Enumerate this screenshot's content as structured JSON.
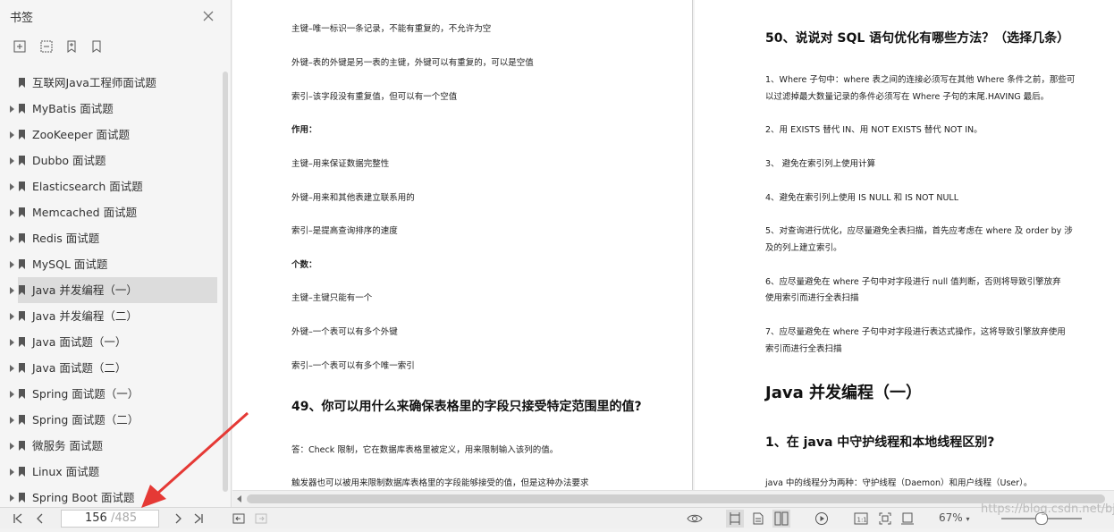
{
  "sidebar": {
    "title": "书签",
    "items": [
      {
        "label": "互联网Java工程师面试题",
        "expandable": false
      },
      {
        "label": "MyBatis 面试题",
        "expandable": true
      },
      {
        "label": "ZooKeeper 面试题",
        "expandable": true
      },
      {
        "label": "Dubbo 面试题",
        "expandable": true
      },
      {
        "label": "Elasticsearch 面试题",
        "expandable": true
      },
      {
        "label": "Memcached 面试题",
        "expandable": true
      },
      {
        "label": "Redis 面试题",
        "expandable": true
      },
      {
        "label": "MySQL 面试题",
        "expandable": true
      },
      {
        "label": "Java 并发编程（一）",
        "expandable": true,
        "selected": true
      },
      {
        "label": "Java 并发编程（二）",
        "expandable": true
      },
      {
        "label": "Java 面试题（一）",
        "expandable": true
      },
      {
        "label": "Java 面试题（二）",
        "expandable": true
      },
      {
        "label": "Spring 面试题（一）",
        "expandable": true
      },
      {
        "label": "Spring 面试题（二）",
        "expandable": true
      },
      {
        "label": "微服务 面试题",
        "expandable": true
      },
      {
        "label": "Linux 面试题",
        "expandable": true
      },
      {
        "label": "Spring Boot 面试题",
        "expandable": true
      }
    ]
  },
  "left_page": {
    "lines": [
      "主键–唯一标识一条记录，不能有重复的，不允许为空",
      "外键–表的外键是另一表的主键，外键可以有重复的，可以是空值",
      "索引–该字段没有重复值，但可以有一个空值",
      "作用：",
      "主键–用来保证数据完整性",
      "外键–用来和其他表建立联系用的",
      "索引–是提高查询排序的速度",
      "个数：",
      "主键–主键只能有一个",
      "外键–一个表可以有多个外键",
      "索引–一个表可以有多个唯一索引"
    ],
    "heading": "49、你可以用什么来确保表格里的字段只接受特定范围里的值?",
    "para1": "答：Check 限制，它在数据库表格里被定义，用来限制输入该列的值。",
    "para2": "触发器也可以被用来限制数据库表格里的字段能够接受的值，但是这种办法要求"
  },
  "right_page": {
    "heading": "50、说说对 SQL 语句优化有哪些方法？（选择几条）",
    "p1a": "1、Where 子句中：where 表之间的连接必须写在其他 Where 条件之前，那些可",
    "p1b": "以过滤掉最大数量记录的条件必须写在 Where 子句的末尾.HAVING 最后。",
    "p2": "2、用 EXISTS 替代 IN、用 NOT EXISTS 替代 NOT IN。",
    "p3": "3、  避免在索引列上使用计算",
    "p4": "4、避免在索引列上使用 IS NULL 和 IS NOT NULL",
    "p5a": "5、对查询进行优化，应尽量避免全表扫描，首先应考虑在  where  及  order by  涉",
    "p5b": "及的列上建立索引。",
    "p6a": "6、应尽量避免在  where  子句中对字段进行  null  值判断，否则将导致引擎放弃",
    "p6b": "使用索引而进行全表扫描",
    "p7a": "7、应尽量避免在  where  子句中对字段进行表达式操作，这将导致引擎放弃使用",
    "p7b": "索引而进行全表扫描",
    "chapter": "Java 并发编程（一）",
    "subheading": "1、在 java 中守护线程和本地线程区别?",
    "p8": "java 中的线程分为两种：守护线程（Daemon）和用户线程（User）。"
  },
  "status": {
    "current_page": "156",
    "total_pages": "/485",
    "zoom": "67%",
    "watermark": "https://blog.csdn.net/bjmsb"
  },
  "colors": {
    "arrow": "#e53935",
    "selected_bg": "#dcdcdc"
  }
}
